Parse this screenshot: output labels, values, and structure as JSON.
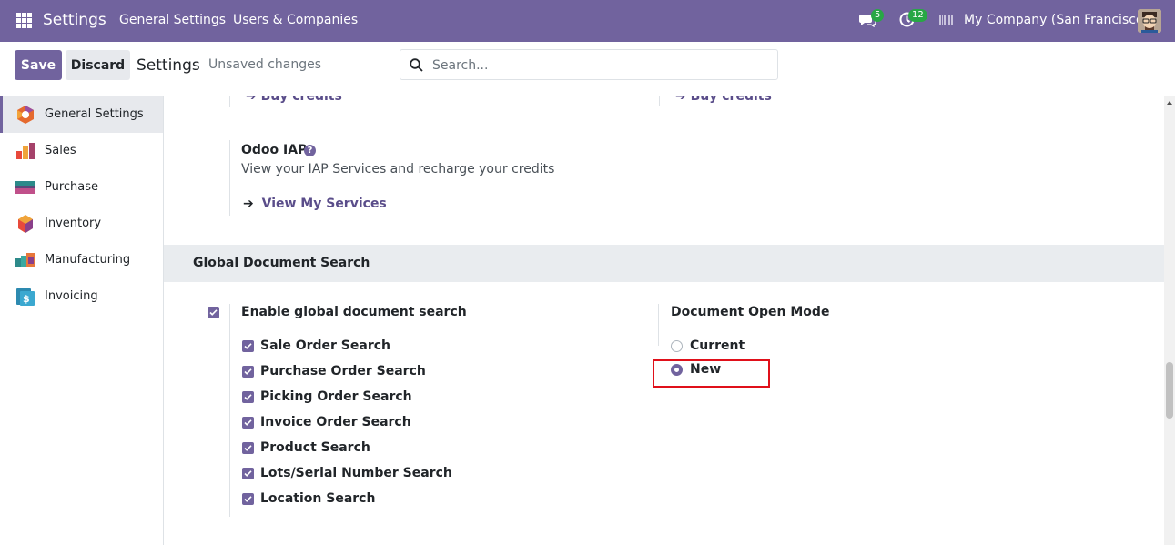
{
  "navbar": {
    "app_title": "Settings",
    "menu": [
      "General Settings",
      "Users & Companies"
    ],
    "chat_count": "5",
    "activity_count": "12",
    "company": "My Company (San Francisco)"
  },
  "control_panel": {
    "save_label": "Save",
    "discard_label": "Discard",
    "breadcrumb": "Settings",
    "status": "Unsaved changes",
    "search_placeholder": "Search..."
  },
  "sidebar": {
    "items": [
      {
        "label": "General Settings",
        "active": true
      },
      {
        "label": "Sales"
      },
      {
        "label": "Purchase"
      },
      {
        "label": "Inventory"
      },
      {
        "label": "Manufacturing"
      },
      {
        "label": "Invoicing"
      }
    ]
  },
  "main": {
    "top_links": [
      "Buy credits",
      "Buy credits"
    ],
    "iap": {
      "title": "Odoo IAP",
      "description": "View your IAP Services and recharge your credits",
      "link": "View My Services"
    },
    "section": {
      "title": "Global Document Search",
      "enable_label": "Enable global document search",
      "options": [
        "Sale Order Search",
        "Purchase Order Search",
        "Picking Order Search",
        "Invoice Order Search",
        "Product Search",
        "Lots/Serial Number Search",
        "Location Search"
      ],
      "open_mode": {
        "title": "Document Open Mode",
        "choices": [
          "Current",
          "New"
        ],
        "selected": "New"
      }
    }
  },
  "colors": {
    "brand": "#71639e",
    "highlight": "#e0101a"
  }
}
